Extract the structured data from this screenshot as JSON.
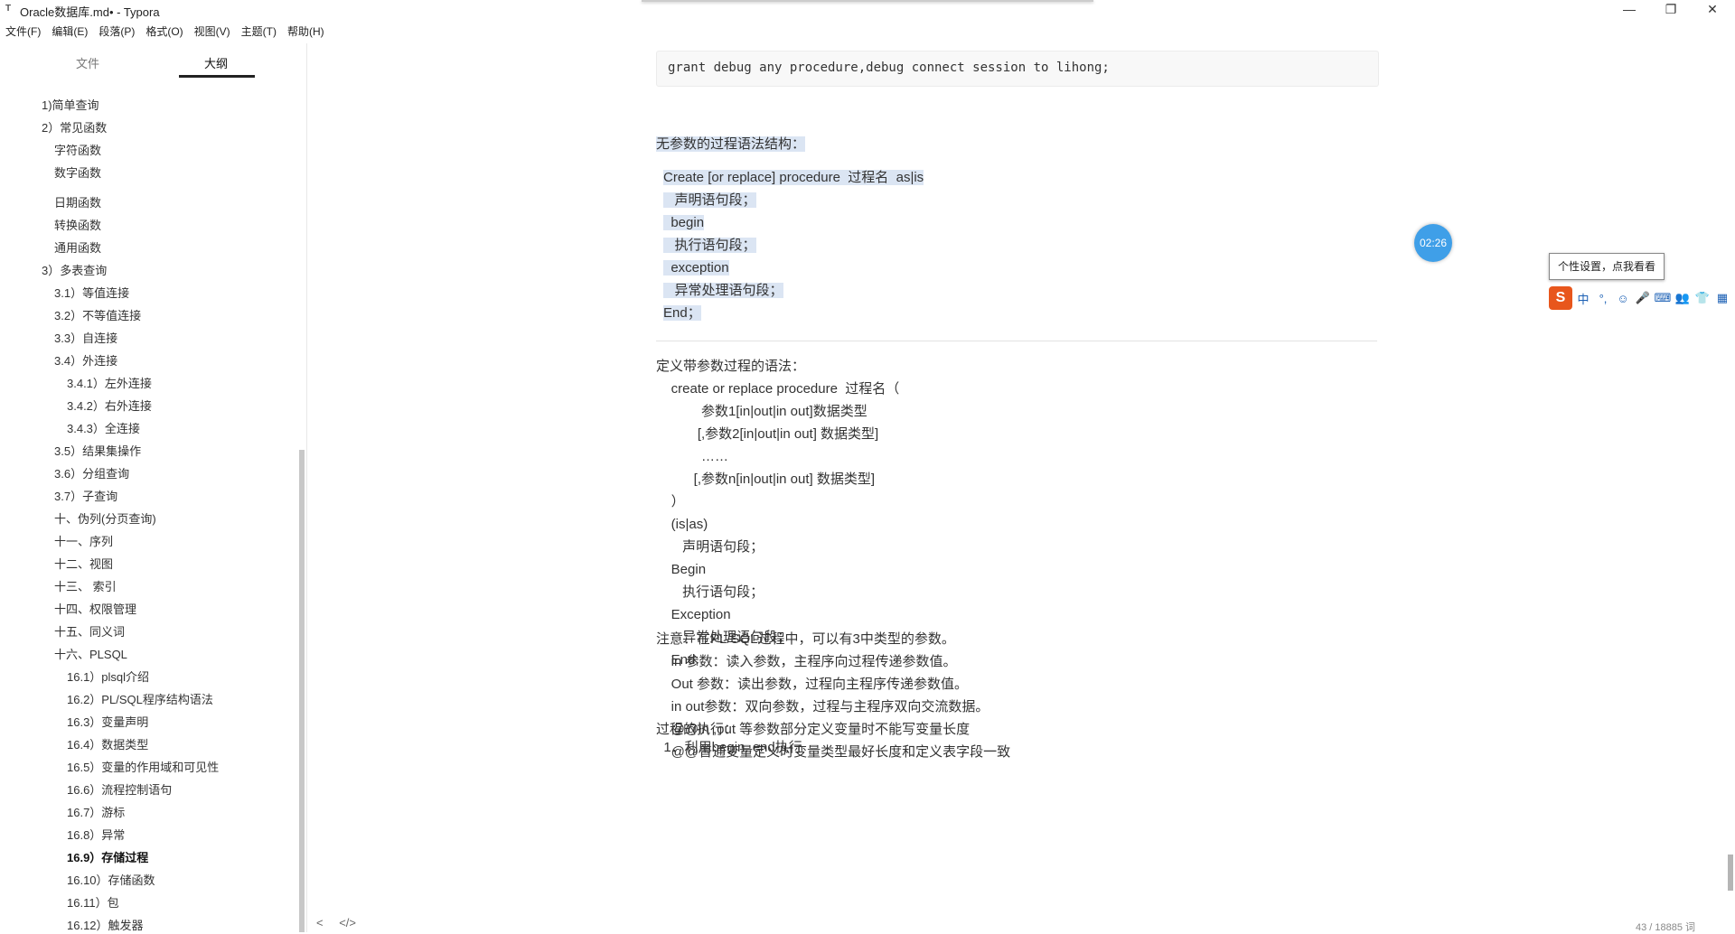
{
  "window": {
    "title": "Oracle数据库.md• - Typora",
    "controls": [
      "—",
      "❐",
      "✕"
    ]
  },
  "menu": [
    "文件(F)",
    "编辑(E)",
    "段落(P)",
    "格式(O)",
    "视图(V)",
    "主题(T)",
    "帮助(H)"
  ],
  "sidebar": {
    "tabs": [
      "文件",
      "大纲"
    ],
    "active_tab": "大纲",
    "outline": [
      "1)简单查询",
      "2）常见函数",
      "字符函数",
      "数字函数",
      "日期函数",
      "转换函数",
      "通用函数",
      "3）多表查询",
      "3.1）等值连接",
      "3.2）不等值连接",
      "3.3）自连接",
      "3.4）外连接",
      "3.4.1）左外连接",
      "3.4.2）右外连接",
      "3.4.3）全连接",
      "3.5）结果集操作",
      "3.6）分组查询",
      "3.7）子查询",
      "十、伪列(分页查询)",
      "十一、序列",
      "十二、视图",
      "十三、 索引",
      "十四、权限管理",
      "十五、同义词",
      "十六、PLSQL",
      "16.1）plsql介绍",
      "16.2）PL/SQL程序结构语法",
      "16.3）变量声明",
      "16.4）数据类型",
      "16.5）变量的作用域和可见性",
      "16.6）流程控制语句",
      "16.7）游标",
      "16.8）异常",
      "16.9）存储过程",
      "16.10）存储函数",
      "16.11）包",
      "16.12）触发器"
    ],
    "active_item": "16.9）存储过程"
  },
  "editor": {
    "code": "grant debug any procedure,debug connect session to lihong;",
    "noparam_title": "无参数的过程语法结构：",
    "noparam_lines": [
      "Create [or replace] procedure  过程名  as|is",
      "   声明语句段；",
      "  begin",
      "   执行语句段；",
      "  exception",
      "   异常处理语句段；",
      "End；"
    ],
    "param_lines": [
      "定义带参数过程的语法：",
      "    create or replace procedure  过程名（",
      "            参数1[in|out|in out]数据类型",
      "           [,参数2[in|out|in out] 数据类型]",
      "            ……",
      "          [,参数n[in|out|in out] 数据类型]",
      "    ）",
      "    (is|as)",
      "       声明语句段；",
      "    Begin",
      "       执行语句段；",
      "    Exception",
      "       异常处理语句段；",
      "    End;"
    ],
    "note_lines": [
      "注意：在PL/SQL过程中，可以有3中类型的参数。",
      "    in 参数：读入参数，主程序向过程传递参数值。",
      "    Out 参数：读出参数，过程向主程序传递参数值。",
      "    in out参数：双向参数，过程与主程序双向交流数据。",
      "    @@in ,out 等参数部分定义变量时不能写变量长度",
      "    @@普通变量定义时变量类型最好长度和定义表字段一致"
    ],
    "exec_title": "过程的执行：",
    "exec_first": "  1．利用begin..end执行"
  },
  "overlay": {
    "timer": "02:26",
    "ime_tip": "个性设置，点我看看",
    "ime_logo": "S",
    "ime_buttons": [
      "中",
      "°,",
      "☺",
      "🎤",
      "⌨",
      "👥",
      "👕",
      "▦"
    ]
  },
  "status": {
    "nav_left": "<",
    "nav_source": "</>",
    "word_count": "43 / 18885 词"
  }
}
